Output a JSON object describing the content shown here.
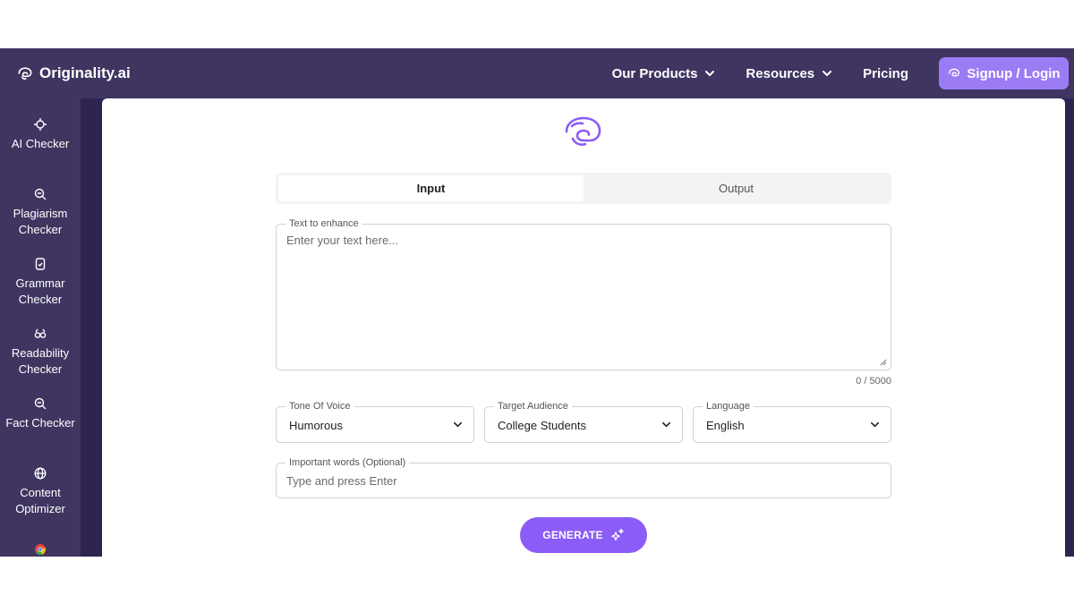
{
  "header": {
    "logo_text": "Originality.ai",
    "nav": [
      {
        "label": "Our Products",
        "icon": "chevron-down-icon"
      },
      {
        "label": "Resources",
        "icon": "chevron-down-icon"
      },
      {
        "label": "Pricing"
      }
    ],
    "login_label": "Signup / Login"
  },
  "sidebar": {
    "items": [
      {
        "label": "AI Checker",
        "icon": "target-icon"
      },
      {
        "label": "Plagiarism Checker",
        "icon": "magnify-icon"
      },
      {
        "label": "Grammar Checker",
        "icon": "document-check-icon"
      },
      {
        "label": "Readability Checker",
        "icon": "glasses-icon"
      },
      {
        "label": "Fact Checker",
        "icon": "magnify-icon"
      },
      {
        "label": "Content Optimizer",
        "icon": "globe-icon"
      }
    ],
    "extra_icon": "chrome-icon"
  },
  "main": {
    "tabs": [
      {
        "label": "Input",
        "active": true
      },
      {
        "label": "Output",
        "active": false
      }
    ],
    "text_field": {
      "label": "Text to enhance",
      "placeholder": "Enter your text here..."
    },
    "char_counter": "0 / 5000",
    "selects": [
      {
        "label": "Tone Of Voice",
        "value": "Humorous"
      },
      {
        "label": "Target Audience",
        "value": "College Students"
      },
      {
        "label": "Language",
        "value": "English"
      }
    ],
    "important_words": {
      "label": "Important words (Optional)",
      "placeholder": "Type and press Enter"
    },
    "generate_label": "GENERATE"
  },
  "colors": {
    "header_bg": "#3f3560",
    "accent": "#8b5cf6",
    "login_bg": "#9b7cf5"
  }
}
